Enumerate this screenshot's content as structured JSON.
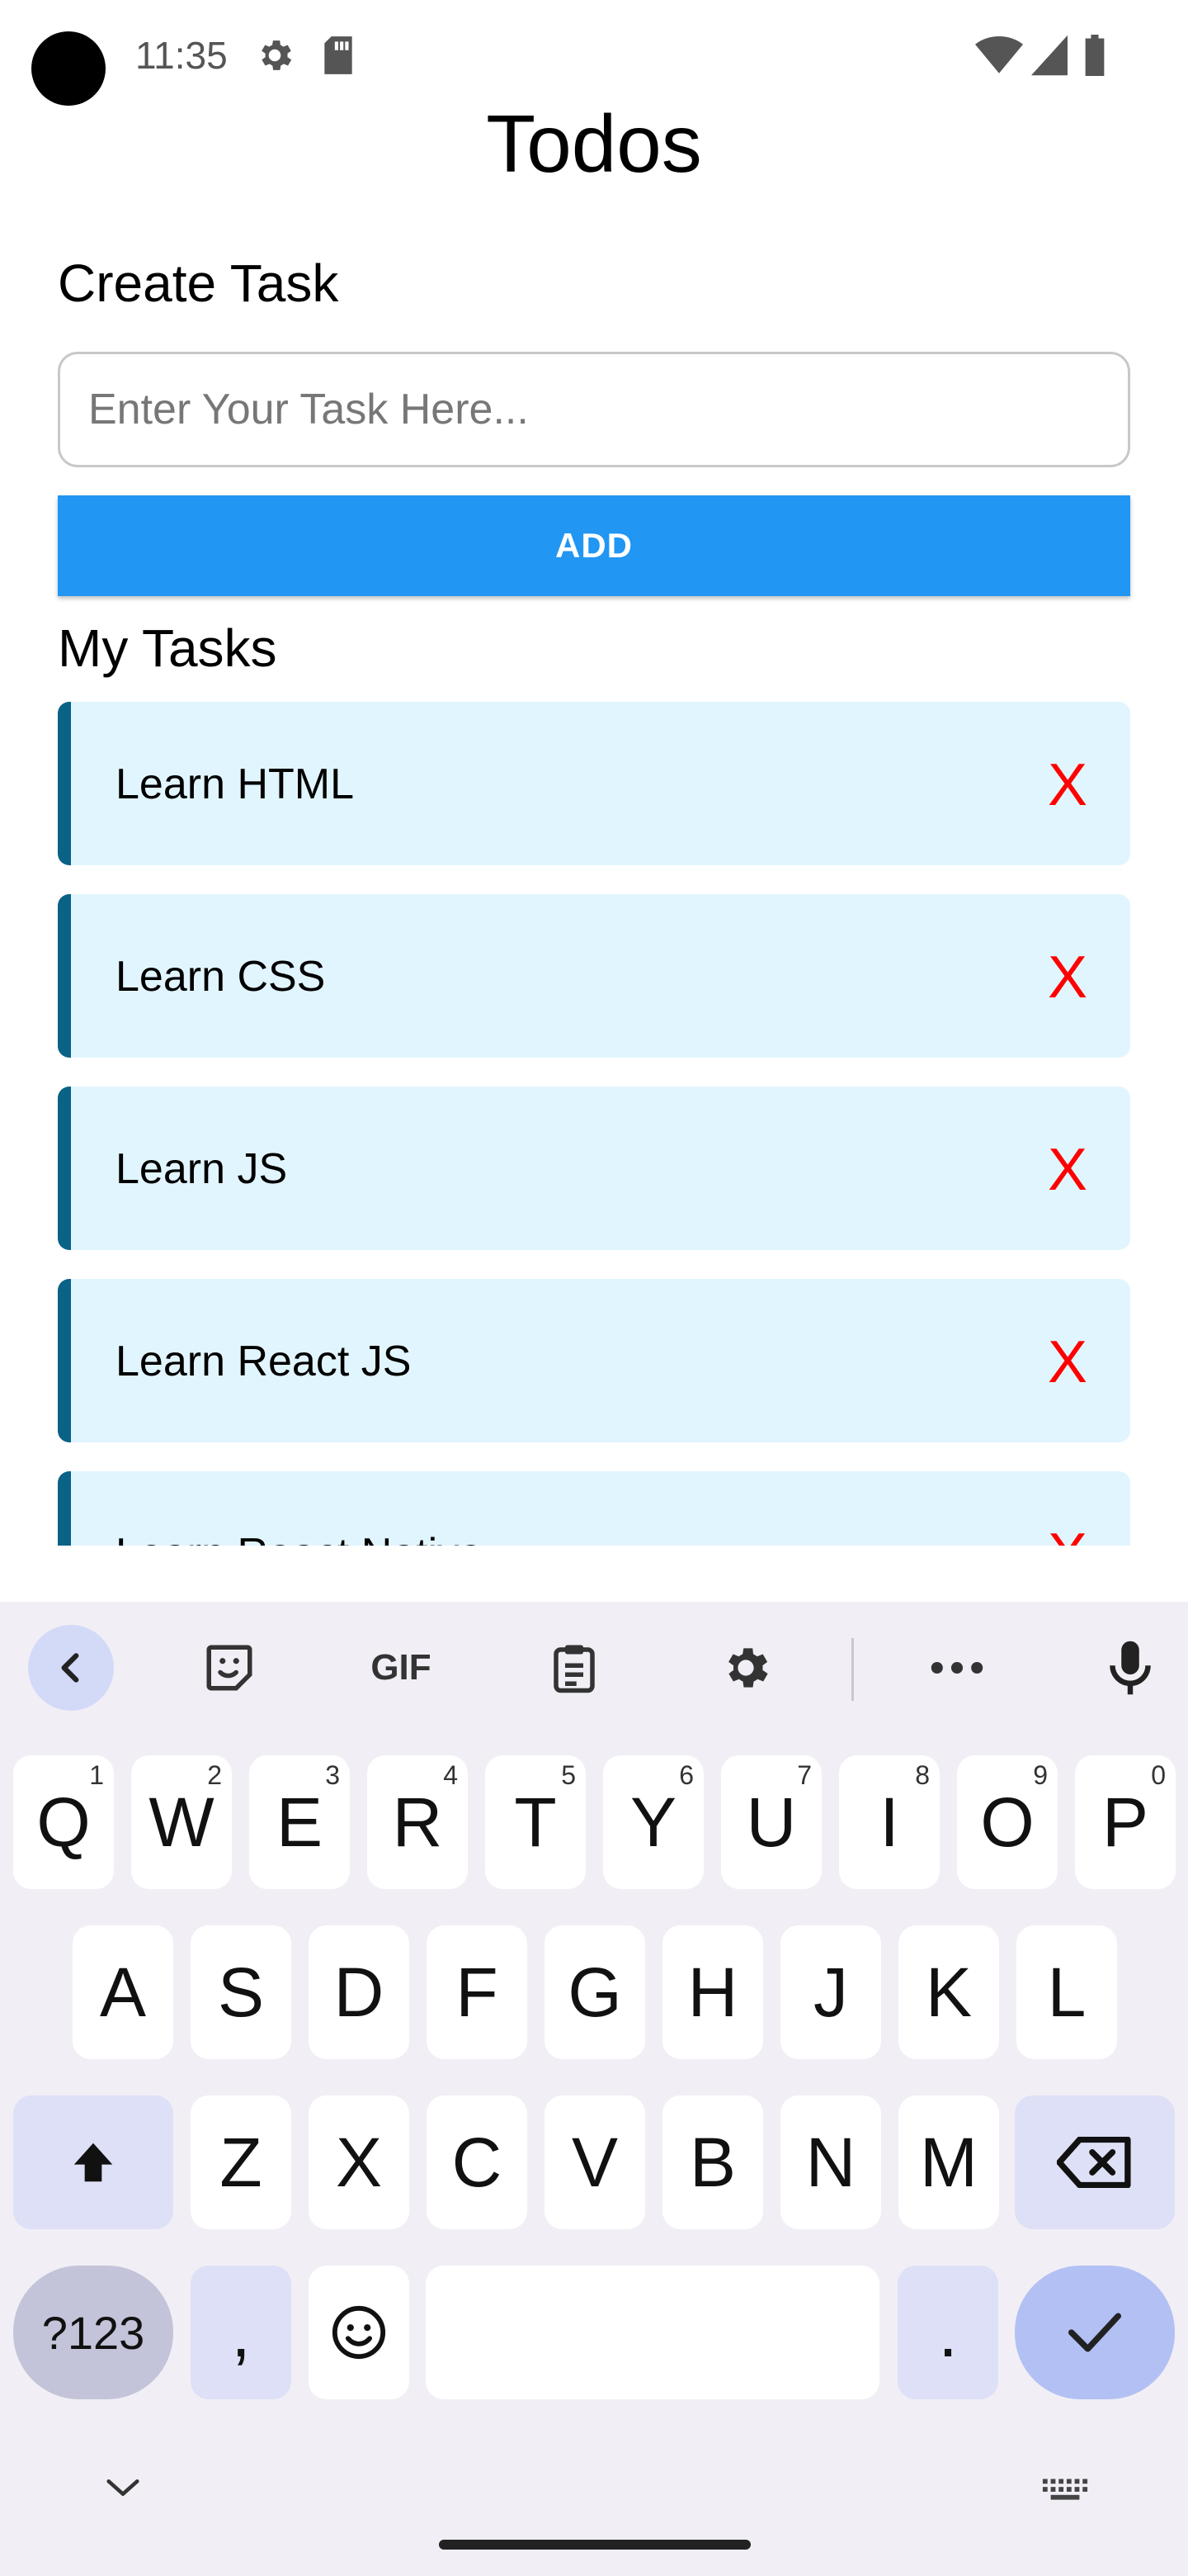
{
  "status_bar": {
    "time": "11:35",
    "icons": [
      "settings-gear-icon",
      "sd-card-icon",
      "wifi-icon",
      "signal-icon",
      "battery-icon"
    ]
  },
  "app": {
    "title": "Todos",
    "create_label": "Create Task",
    "input_placeholder": "Enter Your Task Here...",
    "add_button": "ADD",
    "list_label": "My Tasks",
    "tasks": [
      {
        "text": "Learn HTML",
        "delete_label": "X"
      },
      {
        "text": "Learn CSS",
        "delete_label": "X"
      },
      {
        "text": "Learn JS",
        "delete_label": "X"
      },
      {
        "text": "Learn React JS",
        "delete_label": "X"
      },
      {
        "text": "Learn React Native",
        "delete_label": "X"
      }
    ],
    "colors": {
      "accent": "#2196f3",
      "task_bg": "#e1f5fe",
      "task_border": "#0a6286",
      "delete": "#ff0000"
    }
  },
  "keyboard": {
    "toolbar": [
      "back-chevron-icon",
      "sticker-icon",
      "GIF",
      "clipboard-icon",
      "settings-gear-icon",
      "more-dots-icon",
      "microphone-icon"
    ],
    "gif_label": "GIF",
    "row1": [
      {
        "k": "Q",
        "h": "1"
      },
      {
        "k": "W",
        "h": "2"
      },
      {
        "k": "E",
        "h": "3"
      },
      {
        "k": "R",
        "h": "4"
      },
      {
        "k": "T",
        "h": "5"
      },
      {
        "k": "Y",
        "h": "6"
      },
      {
        "k": "U",
        "h": "7"
      },
      {
        "k": "I",
        "h": "8"
      },
      {
        "k": "O",
        "h": "9"
      },
      {
        "k": "P",
        "h": "0"
      }
    ],
    "row2": [
      "A",
      "S",
      "D",
      "F",
      "G",
      "H",
      "J",
      "K",
      "L"
    ],
    "row3": [
      "Z",
      "X",
      "C",
      "V",
      "B",
      "N",
      "M"
    ],
    "bottom": {
      "symbols": "?123",
      "comma": ",",
      "period": "."
    }
  }
}
